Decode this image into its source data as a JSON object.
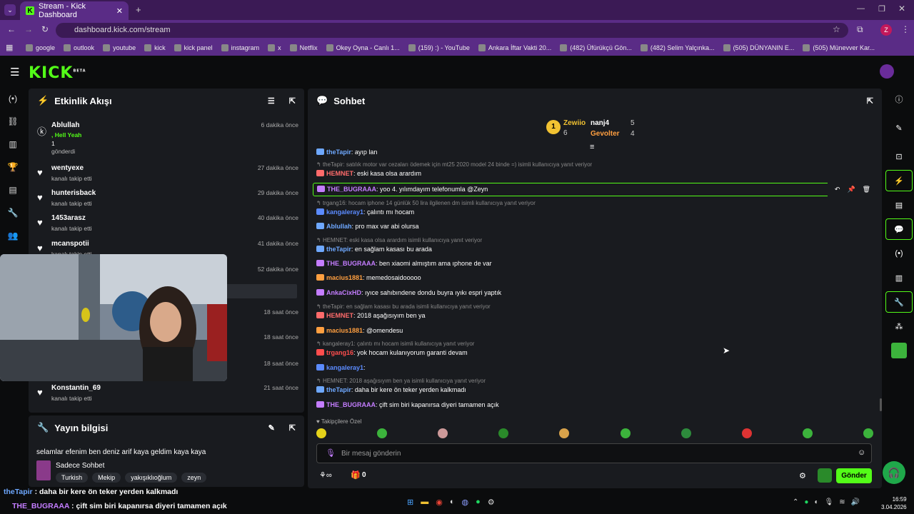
{
  "browser": {
    "tab_title": "Stream - Kick Dashboard",
    "url": "dashboard.kick.com/stream",
    "bookmarks": [
      "google",
      "outlook",
      "youtube",
      "kick",
      "kick panel",
      "instagram",
      "x",
      "Netflix",
      "Okey Oyna - Canlı 1...",
      "(159) :) - YouTube",
      "Ankara İftar Vakti 20...",
      "(482) Üfürükçü Gön...",
      "(482) Selim Yalçınka...",
      "(505) DÜNYANIN E...",
      "(505) Münevver Kar..."
    ]
  },
  "app": {
    "logo": "KICK",
    "logo_sup": "BETA"
  },
  "activity": {
    "title": "Etkinlik Akışı",
    "items": [
      {
        "name": "Ablullah",
        "line2": ", Hell Yeah",
        "line3": "1",
        "sub": "gönderdi",
        "time": "6 dakika önce"
      },
      {
        "name": "wentyexe",
        "sub": "kanalı takip etti",
        "time": "27 dakika önce"
      },
      {
        "name": "hunterisback",
        "sub": "kanalı takip etti",
        "time": "29 dakika önce"
      },
      {
        "name": "1453arasz",
        "sub": "kanalı takip etti",
        "time": "40 dakika önce"
      },
      {
        "name": "mcanspotii",
        "sub": "kanalı takip etti",
        "time": "41 dakika önce"
      },
      {
        "time": "52 dakika önce"
      },
      {
        "time": "18 saat önce"
      },
      {
        "time": "18 saat önce"
      },
      {
        "time": "18 saat önce"
      },
      {
        "name": "Konstantin_69",
        "sub": "kanalı takip etti",
        "time": "21 saat önce"
      }
    ]
  },
  "stream_info": {
    "title": "Yayın bilgisi",
    "stream_title": "selamlar efenim ben deniz arif kaya geldim kaya kaya",
    "category": "Sadece Sohbet",
    "tags": [
      "Turkish",
      "Mekip",
      "yakışıklıoğlum",
      "zeyn"
    ]
  },
  "chat": {
    "title": "Sohbet",
    "leaderboard": {
      "first": {
        "rank": "1",
        "name": "Zewiio",
        "count": "6"
      },
      "second": {
        "name": "nanj4",
        "count": "5"
      },
      "third": {
        "name": "Gevolter",
        "count": "4"
      }
    },
    "messages": [
      {
        "type": "msg",
        "user": "theTapir",
        "color": "#6ea8ff",
        "text": ": ayıp lan"
      },
      {
        "type": "reply",
        "text": "theTapir: satılık motor var cezaları ödemek için mt25 2020 model 24 binde =) isimli kullanıcıya yanıt veriyor"
      },
      {
        "type": "msg",
        "user": "HEMNET",
        "color": "#ff6b6b",
        "text": ": eski kasa olsa arardım"
      },
      {
        "type": "hl",
        "user": "THE_BUGRAAA",
        "color": "#c47dff",
        "text": ": yoo 4. yılımdayım telefonumla @Zeyn"
      },
      {
        "type": "reply",
        "text": "trgang16: hocam iphone 14 günlük 50 lira ilgilenen dm isimli kullanıcıya yanıt veriyor"
      },
      {
        "type": "msg",
        "user": "kangaleray1",
        "color": "#5b8bff",
        "text": ": çalıntı mı hocam"
      },
      {
        "type": "msg",
        "user": "Ablullah",
        "color": "#6ea8ff",
        "text": ": pro max var abi olursa"
      },
      {
        "type": "reply",
        "text": "HEMNET: eski kasa olsa arardım isimli kullanıcıya yanıt veriyor"
      },
      {
        "type": "msg",
        "user": "theTapir",
        "color": "#6ea8ff",
        "text": ": en sağlam kasası bu arada"
      },
      {
        "type": "msg",
        "user": "THE_BUGRAAA",
        "color": "#c47dff",
        "text": ": ben xiaomi almıştım ama ıphone de var"
      },
      {
        "type": "msg",
        "user": "macius1881",
        "color": "#ff9f40",
        "text": ": memedosaidooooo"
      },
      {
        "type": "msg",
        "user": "AnkaCixHD",
        "color": "#c47dff",
        "text": ": ıyıce sahıbındene dondu buyra ıyıkı espri yaptık"
      },
      {
        "type": "reply",
        "text": "theTapir: en sağlam kasası bu arada isimli kullanıcıya yanıt veriyor"
      },
      {
        "type": "msg",
        "user": "HEMNET",
        "color": "#ff6b6b",
        "text": ": 2018 aşağısıyım ben ya"
      },
      {
        "type": "msg",
        "user": "macius1881",
        "color": "#ff9f40",
        "text": ": @omendesu"
      },
      {
        "type": "reply",
        "text": "kangaleray1: çalıntı mı hocam isimli kullanıcıya yanıt veriyor"
      },
      {
        "type": "msg",
        "user": "trgang16",
        "color": "#ff4d4d",
        "text": ": yok hocam kulanıyorum garanti devam"
      },
      {
        "type": "msg",
        "user": "kangaleray1",
        "color": "#5b8bff",
        "text": ":"
      },
      {
        "type": "reply",
        "text": "HEMNET: 2018 aşağısıyım ben ya isimli kullanıcıya yanıt veriyor"
      },
      {
        "type": "msg",
        "user": "theTapir",
        "color": "#6ea8ff",
        "text": ": daha bir kere ön teker yerden kalkmadı"
      },
      {
        "type": "msg",
        "user": "THE_BUGRAAA",
        "color": "#c47dff",
        "text": ": çift sim biri kapanırsa diyeri tamamen açık"
      }
    ],
    "emote_label": "Takipçilere Özel",
    "input_placeholder": "Bir mesaj gönderin",
    "points": "0",
    "send_label": "Gönder"
  },
  "overlay": {
    "line1_user": "theTapir",
    "line1_text": " : daha bir kere ön teker yerden kalkmadı",
    "line2_user": "THE_BUGRAAA",
    "line2_text": " : çift sim biri kapanırsa diyeri tamamen açık"
  },
  "taskbar": {
    "time": "16:59",
    "date": "3.04.2026"
  }
}
